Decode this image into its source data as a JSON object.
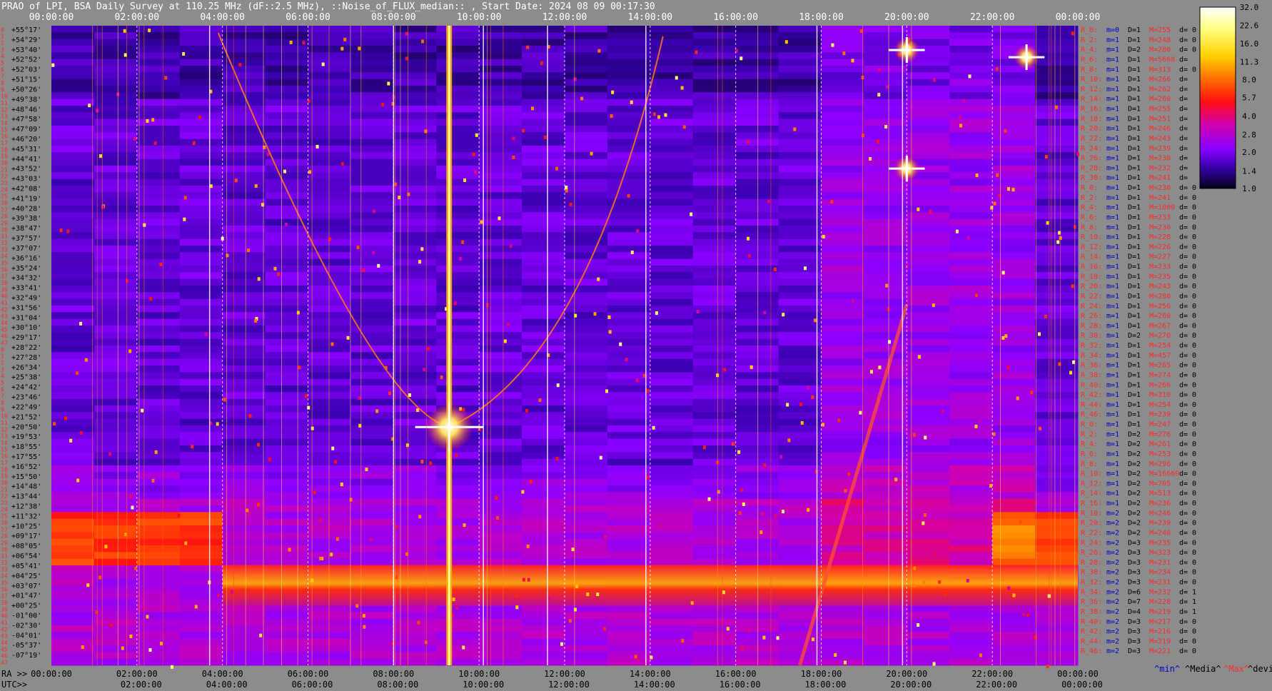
{
  "chart_data": {
    "type": "heatmap",
    "title": "PRAO of LPI, BSA Daily Survey at 110.25 MHz (dF::2.5 MHz), ::Noise_of_FLUX_median:: , Start Date: 2024 08 09 00:17:30",
    "x_axis_top_ticks": [
      "00:00:00",
      "02:00:00",
      "04:00:00",
      "06:00:00",
      "08:00:00",
      "10:00:00",
      "12:00:00",
      "14:00:00",
      "16:00:00",
      "18:00:00",
      "20:00:00",
      "22:00:00",
      "00:00:00"
    ],
    "ra_label": "RA >>",
    "ra_ticks": [
      "00:00:00",
      "02:00:00",
      "04:00:00",
      "06:00:00",
      "08:00:00",
      "10:00:00",
      "12:00:00",
      "14:00:00",
      "16:00:00",
      "18:00:00",
      "20:00:00",
      "22:00:00",
      "00:00:00"
    ],
    "utc_label": "UTC>>",
    "utc_ticks": [
      "02:00:00",
      "04:00:00",
      "06:00:00",
      "08:00:00",
      "10:00:00",
      "12:00:00",
      "14:00:00",
      "16:00:00",
      "18:00:00",
      "20:00:00",
      "22:00:00",
      "00:00:00"
    ],
    "beam_numbers": [
      "0",
      "1",
      "2",
      "3",
      "4",
      "5",
      "6",
      "7",
      "8",
      "9",
      "10",
      "11",
      "12",
      "13",
      "14",
      "15",
      "16",
      "17",
      "18",
      "19",
      "20",
      "21",
      "22",
      "23",
      "24",
      "25",
      "26",
      "27",
      "28",
      "29",
      "30",
      "31",
      "32",
      "33",
      "34",
      "35",
      "36",
      "37",
      "38",
      "39",
      "40",
      "41",
      "42",
      "43",
      "44",
      "45",
      "46",
      "47",
      "0",
      "1",
      "2",
      "3",
      "4",
      "5",
      "6",
      "7",
      "8",
      "9",
      "10",
      "11",
      "12",
      "13",
      "14",
      "15",
      "16",
      "17",
      "18",
      "19",
      "20",
      "21",
      "22",
      "23",
      "24",
      "25",
      "26",
      "27",
      "28",
      "29",
      "30",
      "31",
      "32",
      "33",
      "34",
      "35",
      "36",
      "37",
      "38",
      "39",
      "40",
      "41",
      "42",
      "43",
      "44",
      "45",
      "46",
      "47"
    ],
    "declinations": [
      "+55°17'",
      "+54°29'",
      "+53°40'",
      "+52°52'",
      "+52°03'",
      "+51°15'",
      "+50°26'",
      "+49°38'",
      "+48°46'",
      "+47°58'",
      "+47°09'",
      "+46°20'",
      "+45°31'",
      "+44°41'",
      "+43°52'",
      "+43°03'",
      "+42°08'",
      "+41°19'",
      "+40°28'",
      "+39°38'",
      "+38°47'",
      "+37°57'",
      "+37°07'",
      "+36°16'",
      "+35°24'",
      "+34°32'",
      "+33°41'",
      "+32°49'",
      "+31°56'",
      "+31°04'",
      "+30°10'",
      "+29°17'",
      "+28°22'",
      "+27°28'",
      "+26°34'",
      "+25°38'",
      "+24°42'",
      "+23°46'",
      "+22°49'",
      "+21°52'",
      "+20°50'",
      "+19°53'",
      "+18°55'",
      "+17°55'",
      "+16°52'",
      "+15°50'",
      "+14°48'",
      "+13°44'",
      "+12°38'",
      "+11°32'",
      "+10°25'",
      "+09°17'",
      "+08°05'",
      "+06°54'",
      "+05°41'",
      "+04°25'",
      "+03°07'",
      "+01°47'",
      "+00°25'",
      "-01°00'",
      "-02°30'",
      "-04°01'",
      "-05°37'",
      "-07°19'"
    ],
    "colorbar": {
      "ticks": [
        "32.0",
        "22.6",
        "16.0",
        "11.3",
        "8.0",
        "5.7",
        "4.0",
        "2.8",
        "2.0",
        "1.4",
        "1.0"
      ],
      "min": 1.0,
      "max": 32.0,
      "scale": "log"
    },
    "stats_rows": [
      {
        "r": "R_0:",
        "m": "m=0",
        "d": "D=1",
        "M": "M=255",
        "dv": "d= 0"
      },
      {
        "r": "R_2:",
        "m": "m=1",
        "d": "D=1",
        "M": "M=248",
        "dv": "d= 0"
      },
      {
        "r": "R_4:",
        "m": "m=1",
        "d": "D=2",
        "M": "M=280",
        "dv": "d= 0"
      },
      {
        "r": "R_6:",
        "m": "m=1",
        "d": "D=1",
        "M": "M=5668",
        "dv": "d="
      },
      {
        "r": "R_8:",
        "m": "m=1",
        "d": "D=1",
        "M": "M=313",
        "dv": "d= 0"
      },
      {
        "r": "R_10:",
        "m": "m=1",
        "d": "D=1",
        "M": "M=266",
        "dv": "d="
      },
      {
        "r": "R_12:",
        "m": "m=1",
        "d": "D=1",
        "M": "M=262",
        "dv": "d="
      },
      {
        "r": "R_14:",
        "m": "m=1",
        "d": "D=1",
        "M": "M=260",
        "dv": "d="
      },
      {
        "r": "R_16:",
        "m": "m=1",
        "d": "D=1",
        "M": "M=255",
        "dv": "d="
      },
      {
        "r": "R_18:",
        "m": "m=1",
        "d": "D=1",
        "M": "M=251",
        "dv": "d="
      },
      {
        "r": "R_20:",
        "m": "m=1",
        "d": "D=1",
        "M": "M=246",
        "dv": "d="
      },
      {
        "r": "R_22:",
        "m": "m=1",
        "d": "D=1",
        "M": "M=243",
        "dv": "d="
      },
      {
        "r": "R_24:",
        "m": "m=1",
        "d": "D=1",
        "M": "M=239",
        "dv": "d="
      },
      {
        "r": "R_26:",
        "m": "m=1",
        "d": "D=1",
        "M": "M=238",
        "dv": "d="
      },
      {
        "r": "R_28:",
        "m": "m=1",
        "d": "D=1",
        "M": "M=232",
        "dv": "d="
      },
      {
        "r": "R_30:",
        "m": "m=1",
        "d": "D=1",
        "M": "M=241",
        "dv": "d="
      },
      {
        "r": "R_0:",
        "m": "m=1",
        "d": "D=1",
        "M": "M=238",
        "dv": "d= 0"
      },
      {
        "r": "R_2:",
        "m": "m=1",
        "d": "D=1",
        "M": "M=241",
        "dv": "d= 0"
      },
      {
        "r": "R_4:",
        "m": "m=1",
        "d": "D=1",
        "M": "M=1080",
        "dv": "d= 0"
      },
      {
        "r": "R_6:",
        "m": "m=1",
        "d": "D=1",
        "M": "M=233",
        "dv": "d= 0"
      },
      {
        "r": "R_8:",
        "m": "m=1",
        "d": "D=1",
        "M": "M=230",
        "dv": "d= 0"
      },
      {
        "r": "R_10:",
        "m": "m=1",
        "d": "D=1",
        "M": "M=228",
        "dv": "d= 0"
      },
      {
        "r": "R_12:",
        "m": "m=1",
        "d": "D=1",
        "M": "M=226",
        "dv": "d= 0"
      },
      {
        "r": "R_14:",
        "m": "m=1",
        "d": "D=1",
        "M": "M=227",
        "dv": "d= 0"
      },
      {
        "r": "R_16:",
        "m": "m=1",
        "d": "D=1",
        "M": "M=233",
        "dv": "d= 0"
      },
      {
        "r": "R_18:",
        "m": "m=1",
        "d": "D=1",
        "M": "M=235",
        "dv": "d= 0"
      },
      {
        "r": "R_20:",
        "m": "m=1",
        "d": "D=1",
        "M": "M=243",
        "dv": "d= 0"
      },
      {
        "r": "R_22:",
        "m": "m=1",
        "d": "D=1",
        "M": "M=280",
        "dv": "d= 0"
      },
      {
        "r": "R_24:",
        "m": "m=1",
        "d": "D=1",
        "M": "M=256",
        "dv": "d= 0"
      },
      {
        "r": "R_26:",
        "m": "m=1",
        "d": "D=1",
        "M": "M=260",
        "dv": "d= 0"
      },
      {
        "r": "R_28:",
        "m": "m=1",
        "d": "D=1",
        "M": "M=267",
        "dv": "d= 0"
      },
      {
        "r": "R_30:",
        "m": "m=1",
        "d": "D=2",
        "M": "M=270",
        "dv": "d= 0"
      },
      {
        "r": "R_32:",
        "m": "m=1",
        "d": "D=1",
        "M": "M=254",
        "dv": "d= 0"
      },
      {
        "r": "R_34:",
        "m": "m=1",
        "d": "D=1",
        "M": "M=457",
        "dv": "d= 0"
      },
      {
        "r": "R_36:",
        "m": "m=1",
        "d": "D=1",
        "M": "M=265",
        "dv": "d= 0"
      },
      {
        "r": "R_38:",
        "m": "m=1",
        "d": "D=1",
        "M": "M=274",
        "dv": "d= 0"
      },
      {
        "r": "R_40:",
        "m": "m=1",
        "d": "D=1",
        "M": "M=266",
        "dv": "d= 0"
      },
      {
        "r": "R_42:",
        "m": "m=1",
        "d": "D=1",
        "M": "M=310",
        "dv": "d= 0"
      },
      {
        "r": "R_44:",
        "m": "m=1",
        "d": "D=1",
        "M": "M=254",
        "dv": "d= 0"
      },
      {
        "r": "R_46:",
        "m": "m=1",
        "d": "D=1",
        "M": "M=239",
        "dv": "d= 0"
      },
      {
        "r": "R_0:",
        "m": "m=1",
        "d": "D=1",
        "M": "M=247",
        "dv": "d= 0"
      },
      {
        "r": "R_2:",
        "m": "m=1",
        "d": "D=2",
        "M": "M=276",
        "dv": "d= 0"
      },
      {
        "r": "R_4:",
        "m": "m=1",
        "d": "D=2",
        "M": "M=261",
        "dv": "d= 0"
      },
      {
        "r": "R_6:",
        "m": "m=1",
        "d": "D=2",
        "M": "M=253",
        "dv": "d= 0"
      },
      {
        "r": "R_8:",
        "m": "m=1",
        "d": "D=2",
        "M": "M=296",
        "dv": "d= 0"
      },
      {
        "r": "R_10:",
        "m": "m=1",
        "d": "D=2",
        "M": "M=16669",
        "dv": "d= 0"
      },
      {
        "r": "R_12:",
        "m": "m=1",
        "d": "D=2",
        "M": "M=705",
        "dv": "d= 0"
      },
      {
        "r": "R_14:",
        "m": "m=1",
        "d": "D=2",
        "M": "M=513",
        "dv": "d= 0"
      },
      {
        "r": "R_16:",
        "m": "m=1",
        "d": "D=2",
        "M": "M=236",
        "dv": "d= 0"
      },
      {
        "r": "R_18:",
        "m": "m=2",
        "d": "D=2",
        "M": "M=246",
        "dv": "d= 0"
      },
      {
        "r": "R_20:",
        "m": "m=2",
        "d": "D=2",
        "M": "M=239",
        "dv": "d= 0"
      },
      {
        "r": "R_22:",
        "m": "m=2",
        "d": "D=2",
        "M": "M=248",
        "dv": "d= 0"
      },
      {
        "r": "R_24:",
        "m": "m=2",
        "d": "D=3",
        "M": "M=235",
        "dv": "d= 0"
      },
      {
        "r": "R_26:",
        "m": "m=2",
        "d": "D=3",
        "M": "M=323",
        "dv": "d= 0"
      },
      {
        "r": "R_28:",
        "m": "m=2",
        "d": "D=3",
        "M": "M=231",
        "dv": "d= 0"
      },
      {
        "r": "R_30:",
        "m": "m=2",
        "d": "D=3",
        "M": "M=234",
        "dv": "d= 0"
      },
      {
        "r": "R_32:",
        "m": "m=2",
        "d": "D=3",
        "M": "M=231",
        "dv": "d= 0"
      },
      {
        "r": "R_34:",
        "m": "m=2",
        "d": "D=6",
        "M": "M=232",
        "dv": "d= 1"
      },
      {
        "r": "R_36:",
        "m": "m=2",
        "d": "D=7",
        "M": "M=228",
        "dv": "d= 1"
      },
      {
        "r": "R_38:",
        "m": "m=2",
        "d": "D=4",
        "M": "M=219",
        "dv": "d= 1"
      },
      {
        "r": "R_40:",
        "m": "m=2",
        "d": "D=3",
        "M": "M=217",
        "dv": "d= 0"
      },
      {
        "r": "R_42:",
        "m": "m=2",
        "d": "D=3",
        "M": "M=216",
        "dv": "d= 0"
      },
      {
        "r": "R_44:",
        "m": "m=2",
        "d": "D=3",
        "M": "M=219",
        "dv": "d= 0"
      },
      {
        "r": "R_46:",
        "m": "m=2",
        "d": "D=3",
        "M": "M=221",
        "dv": "d= 0"
      }
    ],
    "stats_legend": {
      "min": "^min^",
      "median": "^Media^",
      "max": "^Max^",
      "devia": "^devia^"
    },
    "features": [
      {
        "kind": "strong-vertical-source",
        "ra_h": 9.3
      },
      {
        "kind": "point-source",
        "ra_h": 20.0,
        "dec": 41.3
      },
      {
        "kind": "point-source",
        "ra_h": 20.0,
        "dec": 52.9
      },
      {
        "kind": "point-source",
        "ra_h": 22.8,
        "dec": 52.2
      },
      {
        "kind": "burst-cross",
        "ra_h": 9.3,
        "dec": 16.0
      },
      {
        "kind": "galactic-band",
        "dec_from": -1.5,
        "dec_to": 2.5
      }
    ],
    "colors": {
      "background": "#8c8c8c",
      "title": "#ffffff",
      "ra_text": "#000000",
      "beam_text": "#ff2a2a",
      "r_label": "#ff2a2a",
      "m_text": "#0000cc",
      "M_text": "#ff2a2a"
    }
  }
}
